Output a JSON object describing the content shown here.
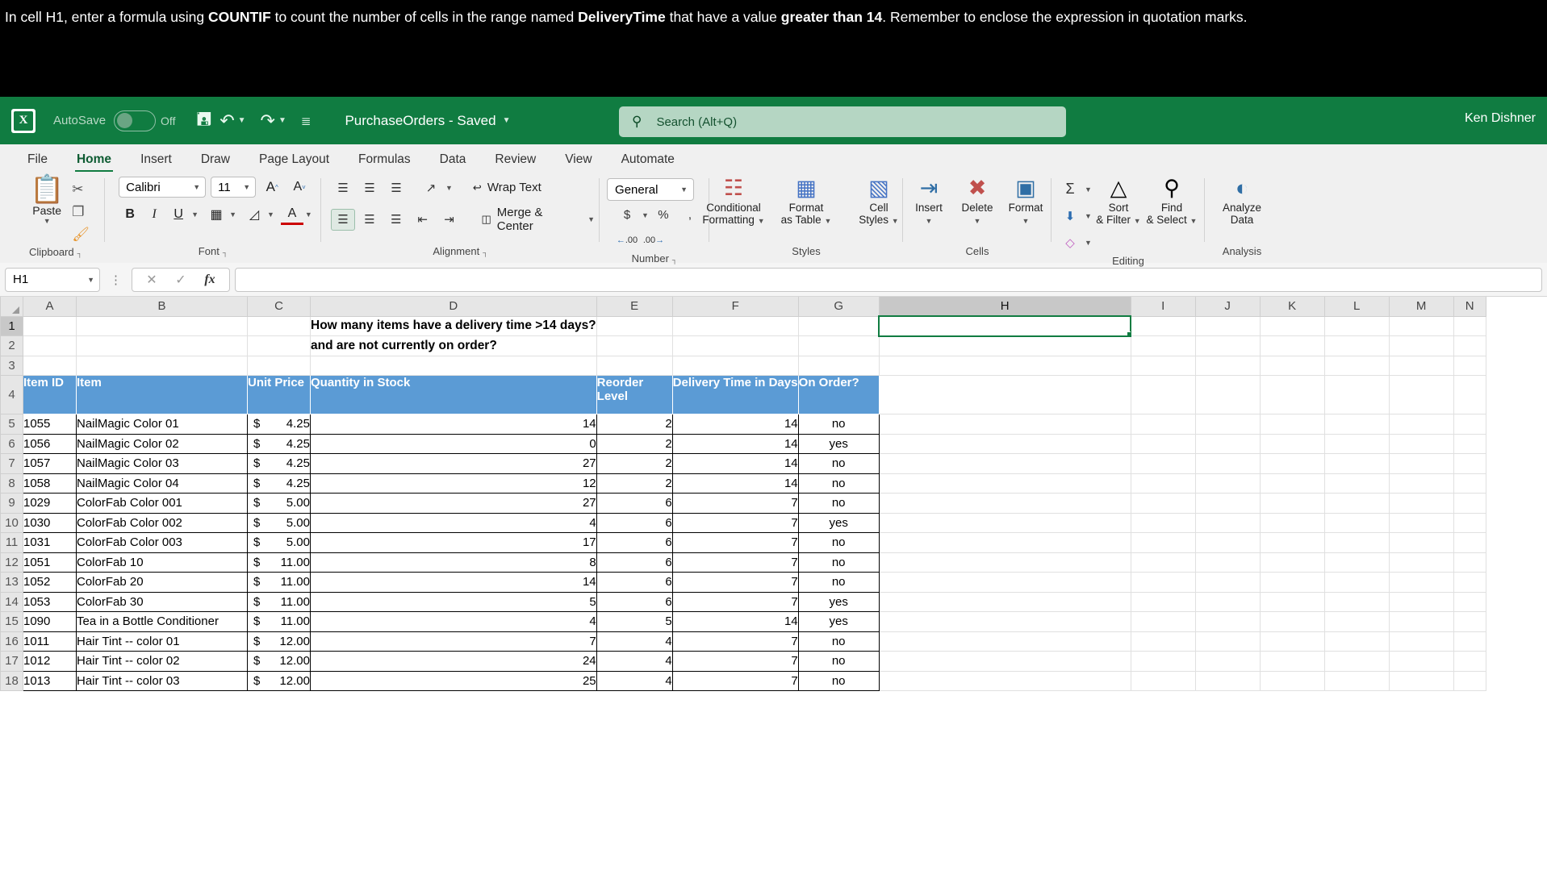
{
  "instruction": {
    "parts": [
      {
        "t": "In cell H1, enter a formula using ",
        "b": false
      },
      {
        "t": "COUNTIF",
        "b": true
      },
      {
        "t": " to count the number of cells in the range named ",
        "b": false
      },
      {
        "t": "DeliveryTime",
        "b": true
      },
      {
        "t": " that have a value ",
        "b": false
      },
      {
        "t": "greater than 14",
        "b": true
      },
      {
        "t": ". Remember to enclose the expression in quotation marks.",
        "b": false
      }
    ]
  },
  "titlebar": {
    "logo_letter": "X",
    "autosave_label": "AutoSave",
    "autosave_state": "Off",
    "save_icon": "ὋE",
    "undo_icon": "undo",
    "redo_icon": "redo",
    "customize_icon": "customize-quick-access",
    "document_title": "PurchaseOrders - Saved",
    "search_placeholder": "Search (Alt+Q)",
    "user_name": "Ken Dishner"
  },
  "tabs": [
    {
      "label": "File",
      "active": false
    },
    {
      "label": "Home",
      "active": true
    },
    {
      "label": "Insert",
      "active": false
    },
    {
      "label": "Draw",
      "active": false
    },
    {
      "label": "Page Layout",
      "active": false
    },
    {
      "label": "Formulas",
      "active": false
    },
    {
      "label": "Data",
      "active": false
    },
    {
      "label": "Review",
      "active": false
    },
    {
      "label": "View",
      "active": false
    },
    {
      "label": "Automate",
      "active": false
    }
  ],
  "ribbon": {
    "clipboard": {
      "group_label": "Clipboard",
      "paste_label": "Paste",
      "cut_icon": "scissors-icon",
      "copy_icon": "copy-icon",
      "format_painter_icon": "format-painter-icon"
    },
    "font": {
      "group_label": "Font",
      "font_name": "Calibri",
      "font_size": "11",
      "grow_font": "A",
      "shrink_font": "A",
      "bold": "B",
      "italic": "I",
      "underline": "U",
      "borders_icon": "borders-icon",
      "fill_color_icon": "fill-color-icon",
      "font_color": "A"
    },
    "alignment": {
      "group_label": "Alignment",
      "wrap_text_label": "Wrap Text",
      "merge_center_label": "Merge & Center",
      "orientation_icon": "orientation-icon"
    },
    "number": {
      "group_label": "Number",
      "format": "General",
      "accounting": "$",
      "percent": "%",
      "comma": ",",
      "decrease_decimal": ".00",
      "increase_decimal": ".00"
    },
    "styles": {
      "group_label": "Styles",
      "conditional_formatting": "Conditional\nFormatting",
      "conditional_formatting_l1": "Conditional",
      "conditional_formatting_l2": "Formatting",
      "format_as_table_l1": "Format",
      "format_as_table_l2": "as Table",
      "cell_styles_l1": "Cell",
      "cell_styles_l2": "Styles"
    },
    "cells": {
      "group_label": "Cells",
      "insert": "Insert",
      "delete": "Delete",
      "format": "Format"
    },
    "editing": {
      "group_label": "Editing",
      "autosum": "Σ",
      "fill_icon": "fill-icon",
      "clear_icon": "clear-icon",
      "sort_filter_l1": "Sort",
      "sort_filter_l2": "& Filter",
      "find_select_l1": "Find",
      "find_select_l2": "& Select"
    },
    "analysis": {
      "group_label": "Analysis",
      "analyze_data_l1": "Analyze",
      "analyze_data_l2": "Data"
    }
  },
  "formula_bar": {
    "name_box": "H1",
    "cancel_icon": "cancel-icon",
    "enter_icon": "confirm-icon",
    "function_icon": "fx",
    "formula_value": ""
  },
  "grid": {
    "columns": [
      "A",
      "B",
      "C",
      "D",
      "E",
      "F",
      "G",
      "H",
      "I",
      "J",
      "K",
      "L",
      "M",
      "N"
    ],
    "selected_column": "H",
    "selected_cell": "H1",
    "question_line1": "How many items have a delivery time >14 days?",
    "question_line2": "and are not currently on order?",
    "header_row_number": 4,
    "headers": [
      "Item ID",
      "Item",
      "Unit Price",
      "Quantity in Stock",
      "Reorder Level",
      "Delivery Time in Days",
      "On Order?"
    ],
    "rows": [
      {
        "n": 5,
        "id": "1055",
        "item": "NailMagic Color 01",
        "price": "4.25",
        "qty": "14",
        "reorder": "2",
        "delivery": "14",
        "onorder": "no"
      },
      {
        "n": 6,
        "id": "1056",
        "item": "NailMagic Color 02",
        "price": "4.25",
        "qty": "0",
        "reorder": "2",
        "delivery": "14",
        "onorder": "yes"
      },
      {
        "n": 7,
        "id": "1057",
        "item": "NailMagic Color 03",
        "price": "4.25",
        "qty": "27",
        "reorder": "2",
        "delivery": "14",
        "onorder": "no"
      },
      {
        "n": 8,
        "id": "1058",
        "item": "NailMagic Color 04",
        "price": "4.25",
        "qty": "12",
        "reorder": "2",
        "delivery": "14",
        "onorder": "no"
      },
      {
        "n": 9,
        "id": "1029",
        "item": "ColorFab Color 001",
        "price": "5.00",
        "qty": "27",
        "reorder": "6",
        "delivery": "7",
        "onorder": "no"
      },
      {
        "n": 10,
        "id": "1030",
        "item": "ColorFab Color 002",
        "price": "5.00",
        "qty": "4",
        "reorder": "6",
        "delivery": "7",
        "onorder": "yes"
      },
      {
        "n": 11,
        "id": "1031",
        "item": "ColorFab Color 003",
        "price": "5.00",
        "qty": "17",
        "reorder": "6",
        "delivery": "7",
        "onorder": "no"
      },
      {
        "n": 12,
        "id": "1051",
        "item": "ColorFab 10",
        "price": "11.00",
        "qty": "8",
        "reorder": "6",
        "delivery": "7",
        "onorder": "no"
      },
      {
        "n": 13,
        "id": "1052",
        "item": "ColorFab 20",
        "price": "11.00",
        "qty": "14",
        "reorder": "6",
        "delivery": "7",
        "onorder": "no"
      },
      {
        "n": 14,
        "id": "1053",
        "item": "ColorFab 30",
        "price": "11.00",
        "qty": "5",
        "reorder": "6",
        "delivery": "7",
        "onorder": "yes"
      },
      {
        "n": 15,
        "id": "1090",
        "item": "Tea in a Bottle Conditioner",
        "price": "11.00",
        "qty": "4",
        "reorder": "5",
        "delivery": "14",
        "onorder": "yes"
      },
      {
        "n": 16,
        "id": "1011",
        "item": "Hair Tint -- color 01",
        "price": "12.00",
        "qty": "7",
        "reorder": "4",
        "delivery": "7",
        "onorder": "no"
      },
      {
        "n": 17,
        "id": "1012",
        "item": "Hair Tint -- color 02",
        "price": "12.00",
        "qty": "24",
        "reorder": "4",
        "delivery": "7",
        "onorder": "no"
      },
      {
        "n": 18,
        "id": "1013",
        "item": "Hair Tint -- color 03",
        "price": "12.00",
        "qty": "25",
        "reorder": "4",
        "delivery": "7",
        "onorder": "no"
      }
    ],
    "empty_rows": [
      1,
      2,
      3
    ],
    "currency_symbol": "$"
  },
  "colors": {
    "excel_green": "#107c41",
    "table_header_blue": "#5b9bd5",
    "selection_green": "#107c41"
  }
}
